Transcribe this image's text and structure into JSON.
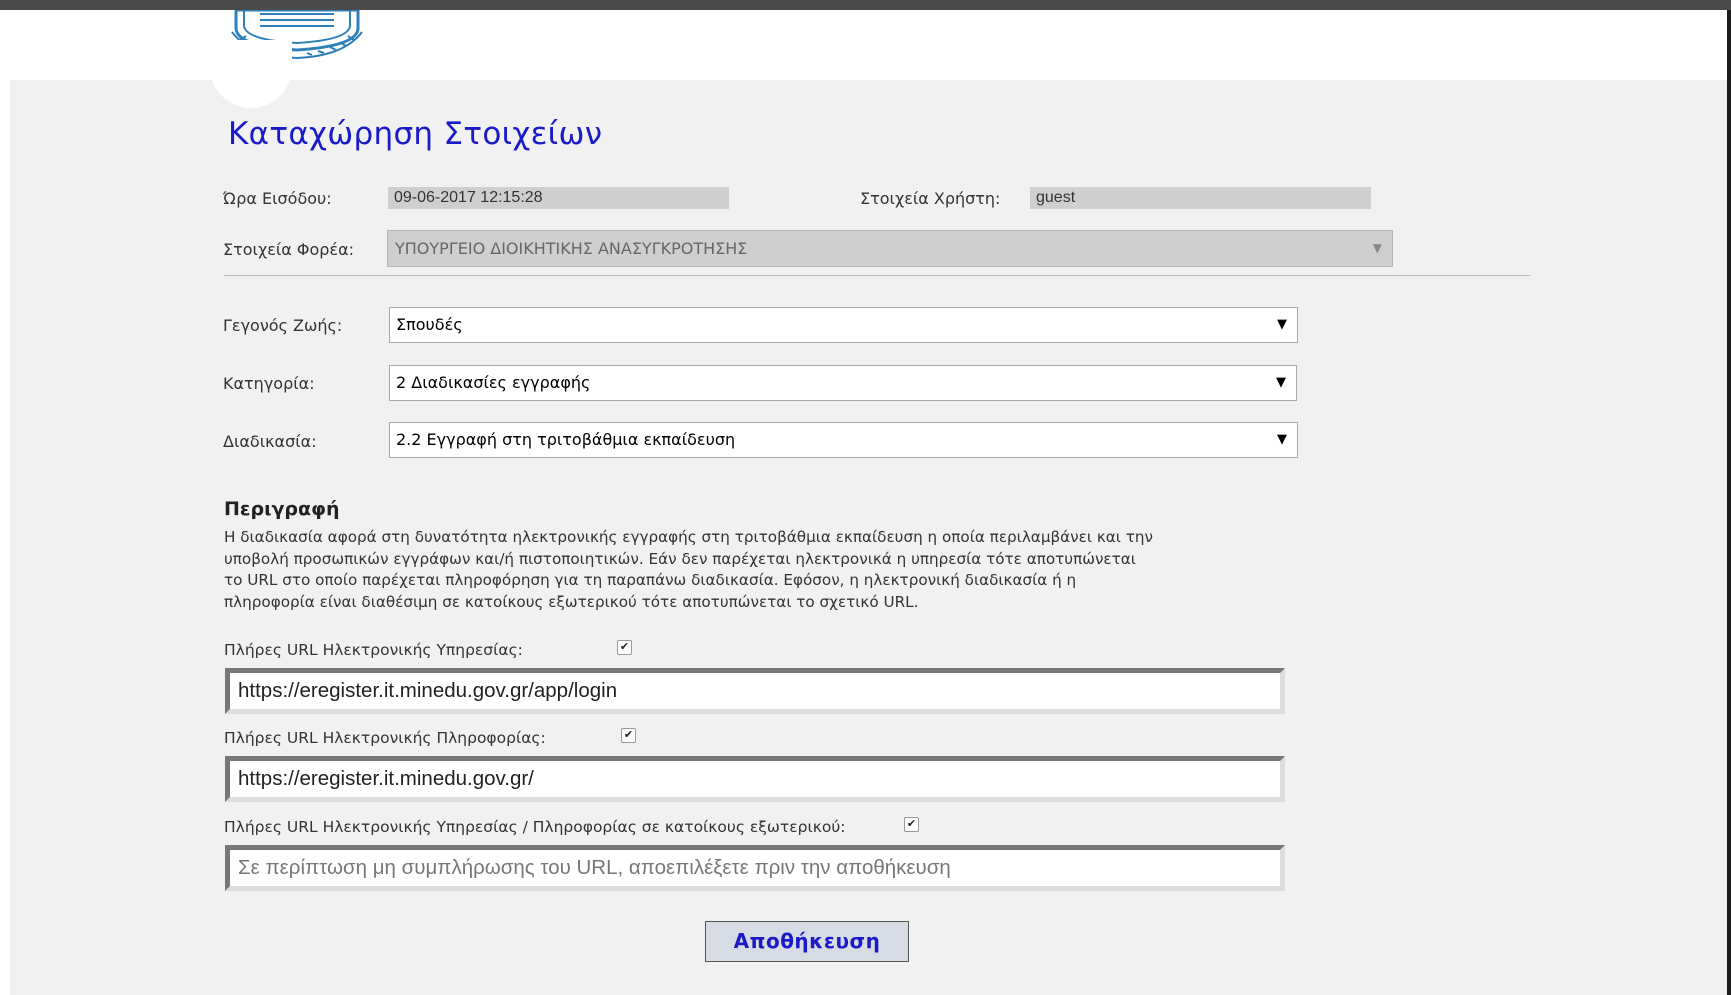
{
  "page": {
    "title": "Καταχώρηση Στοιχείων"
  },
  "header": {
    "logo_icon": "greek-coat-of-arms"
  },
  "login": {
    "time_label": "Ώρα Εισόδου:",
    "time_value": "09-06-2017 12:15:28",
    "user_label": "Στοιχεία Χρήστη:",
    "user_value": "guest"
  },
  "agency": {
    "label": "Στοιχεία Φορέα:",
    "value": "ΥΠΟΥΡΓΕΙΟ ΔΙΟΙΚΗΤΙΚΗΣ ΑΝΑΣΥΓΚΡΟΤΗΣΗΣ"
  },
  "selects": {
    "life_event_label": "Γεγονός Ζωής:",
    "life_event_value": "Σπουδές",
    "category_label": "Κατηγορία:",
    "category_value": "2 Διαδικασίες εγγραφής",
    "procedure_label": "Διαδικασία:",
    "procedure_value": "2.2 Εγγραφή στη τριτοβάθμια εκπαίδευση"
  },
  "description": {
    "heading": "Περιγραφή",
    "line1": "Η διαδικασία αφορά στη δυνατότητα ηλεκτρονικής εγγραφής στη τριτοβάθμια εκπαίδευση η οποία περιλαμβάνει και την",
    "line2": "υποβολή προσωπικών εγγράφων και/ή πιστοποιητικών. Εάν δεν παρέχεται ηλεκτρονικά η υπηρεσία τότε αποτυπώνεται",
    "line3": "το URL στο οποίο παρέχεται πληροφόρηση για τη παραπάνω διαδικασία. Εφόσον, η ηλεκτρονική διαδικασία ή η",
    "line4": "πληροφορία είναι διαθέσιμη σε κατοίκους εξωτερικού τότε αποτυπώνεται το σχετικό URL."
  },
  "urls": {
    "service_label": "Πλήρες URL Ηλεκτρονικής Υπηρεσίας:",
    "service_checked": true,
    "service_value": "https://eregister.it.minedu.gov.gr/app/login",
    "info_label": "Πλήρες URL Ηλεκτρονικής Πληροφορίας:",
    "info_checked": true,
    "info_value": "https://eregister.it.minedu.gov.gr/",
    "abroad_label": "Πλήρες URL Ηλεκτρονικής Υπηρεσίας / Πληροφορίας σε κατοίκους εξωτερικού:",
    "abroad_checked": true,
    "abroad_placeholder": "Σε περίπτωση μη συμπλήρωσης του URL, αποεπιλέξετε πριν την αποθήκευση"
  },
  "actions": {
    "save_label": "Αποθήκευση"
  }
}
